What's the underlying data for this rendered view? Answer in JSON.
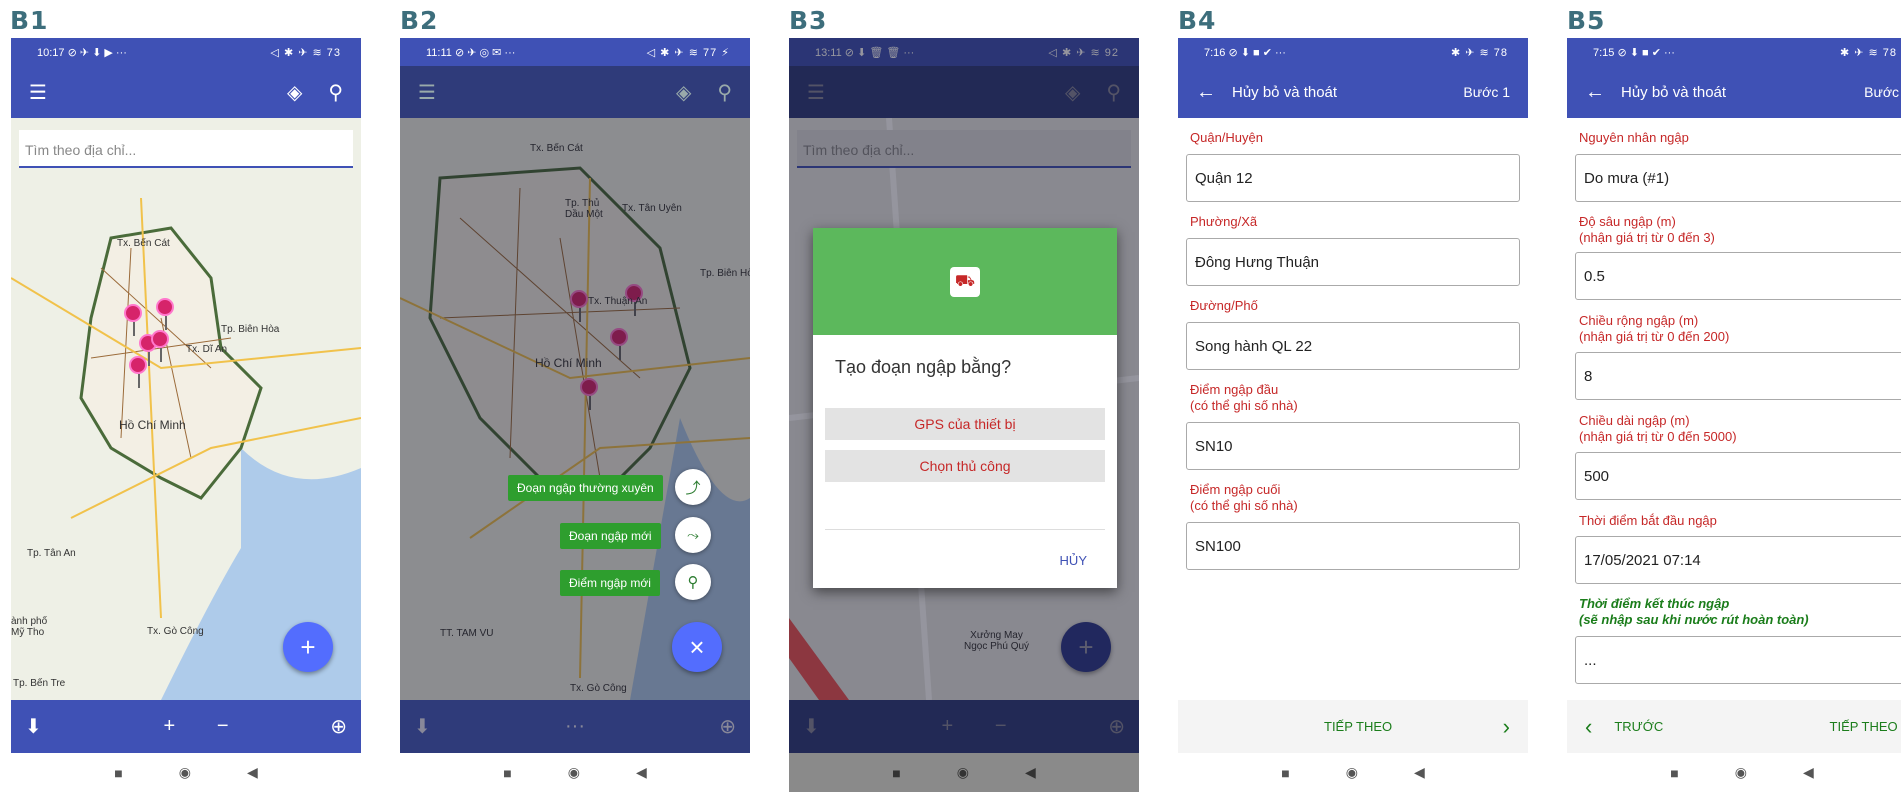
{
  "panels": [
    {
      "label": "B1",
      "time": "10:17 ⊘ ✈ ⬇ ▶ ···",
      "status_right": "◁ ✱ ✈ ≋ 73"
    },
    {
      "label": "B2",
      "time": "11:11 ⊘ ✈ ◎ ✉ ···",
      "status_right": "◁ ✱ ✈ ≋ 77 ⚡"
    },
    {
      "label": "B3",
      "time": "13:11 ⊘ ⬇ 🗑 🗑 ···",
      "status_right": "◁ ✱ ✈ ≋ 92"
    },
    {
      "label": "B4",
      "time": "7:16 ⊘ ⬇ ■ ✔ ···",
      "status_right": "✱ ✈ ≋ 78"
    },
    {
      "label": "B5",
      "time": "7:15 ⊘ ⬇ ■ ✔ ···",
      "status_right": "✱ ✈ ≋ 78"
    }
  ],
  "search_placeholder": "Tìm theo địa chỉ...",
  "map_labels": {
    "b1": [
      "Tx. Bến Cát",
      "Tp. Biên Hòa",
      "Tx. Dĩ An",
      "Hồ Chí Minh",
      "Tp. Tân An",
      "Tx. Gò Công",
      "Tp. Bến Tre",
      "ành phố\nMỹ Tho"
    ],
    "b2": [
      "Tx. Bến Cát",
      "Tx. Tân Uyên",
      "Tp. Thủ\nDầu Một",
      "Tp. Biên Hò",
      "Tx. Thuận An",
      "Hồ Chí Minh",
      "TT. TAM VU",
      "Tx. Gò Công"
    ],
    "b3": [
      "Xưởng May\nNgọc Phú Quý"
    ]
  },
  "b2_menu": {
    "item1": "Đoạn ngập thường xuyên",
    "item2": "Đoạn ngập mới",
    "item3": "Điểm ngập mới"
  },
  "b3_dialog": {
    "title": "Tạo đoạn ngập bằng?",
    "option1": "GPS của thiết bị",
    "option2": "Chọn thủ công",
    "cancel": "HỦY"
  },
  "b4": {
    "appbar_title": "Hủy bỏ và thoát",
    "step": "Bước 1",
    "fields": [
      {
        "label": "Quận/Huyện",
        "value": "Quận 12"
      },
      {
        "label": "Phường/Xã",
        "value": "Đông Hưng Thuận"
      },
      {
        "label": "Đường/Phố",
        "value": "Song hành QL 22"
      },
      {
        "label": "Điểm ngập đầu\n(có thể ghi số nhà)",
        "value": "SN10"
      },
      {
        "label": "Điểm ngập cuối\n(có thể ghi số nhà)",
        "value": "SN100"
      }
    ],
    "next": "TIẾP THEO"
  },
  "b5": {
    "appbar_title": "Hủy bỏ và thoát",
    "step": "Bước",
    "fields": [
      {
        "label": "Nguyên nhân ngập",
        "value": "Do mưa (#1)"
      },
      {
        "label": "Độ sâu ngập (m)\n(nhận giá trị từ 0 đến 3)",
        "value": "0.5"
      },
      {
        "label": "Chiều rộng ngập (m)\n(nhận giá trị từ 0 đến 200)",
        "value": "8"
      },
      {
        "label": "Chiều dài ngập (m)\n(nhận giá trị từ 0 đến 5000)",
        "value": "500"
      },
      {
        "label": "Thời điểm bắt đầu ngập",
        "value": "17/05/2021 07:14"
      },
      {
        "label": "Thời điểm kết thúc ngập\n(sẽ nhập sau khi nước rút hoàn toàn)",
        "value": "..."
      }
    ],
    "prev": "TRƯỚC",
    "next": "TIẾP THEO"
  }
}
